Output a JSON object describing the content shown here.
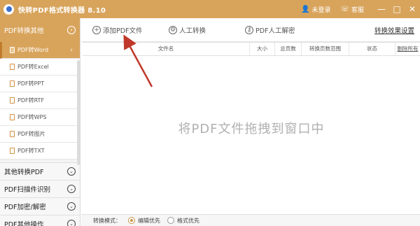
{
  "titlebar": {
    "title": "快转PDF格式转换器 8.10",
    "login": "未登录",
    "service": "客服",
    "min": "—",
    "max": "□",
    "close": "✕"
  },
  "sidebar": {
    "header": "PDF转换其他",
    "sub_items": [
      {
        "label": "PDF转Word",
        "active": true
      },
      {
        "label": "PDF转Excel",
        "active": false
      },
      {
        "label": "PDF转PPT",
        "active": false
      },
      {
        "label": "PDF转RTF",
        "active": false
      },
      {
        "label": "PDF转WPS",
        "active": false
      },
      {
        "label": "PDF转图片",
        "active": false
      },
      {
        "label": "PDF转TXT",
        "active": false
      }
    ],
    "categories": [
      {
        "label": "其他转换PDF"
      },
      {
        "label": "PDF扫描件识别"
      },
      {
        "label": "PDF加密/解密"
      },
      {
        "label": "PDF其他操作"
      }
    ]
  },
  "toolbar": {
    "add_file": "添加PDF文件",
    "manual": "人工转换",
    "manual_decrypt": "PDF人工解密",
    "settings": "转换效果设置"
  },
  "table": {
    "columns": [
      "文件名",
      "大小",
      "总页数",
      "转换页数范围",
      "状态",
      "删除所有"
    ]
  },
  "drop_hint": "将PDF文件拖拽到窗口中",
  "bottom": {
    "mode_label": "转换模式：",
    "option1": "编辑优先",
    "option2": "格式优先"
  },
  "colors": {
    "accent": "#d8a45c",
    "annotation": "#c0392b"
  }
}
